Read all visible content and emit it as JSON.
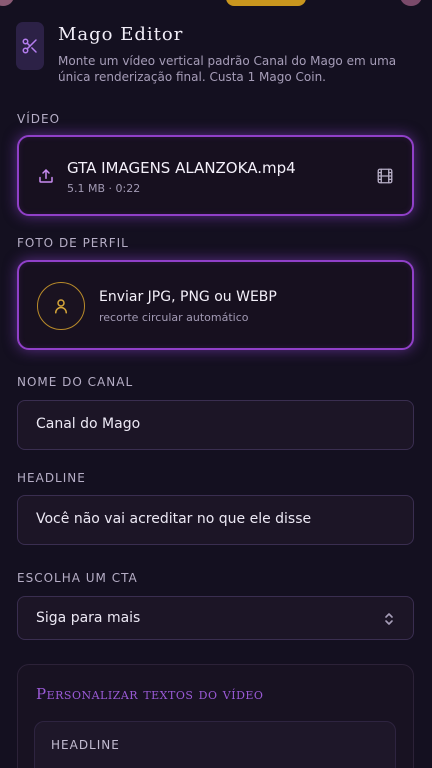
{
  "app": {
    "title": "Mago Editor",
    "description": "Monte um vídeo vertical padrão Canal do Mago em uma única renderização final. Custa 1 Mago Coin.",
    "logo_icon": "scissors-icon",
    "accent_color": "#9040c8"
  },
  "video": {
    "label": "VÍDEO",
    "file_name": "GTA IMAGENS ALANZOKA.mp4",
    "file_meta": "5.1 MB · 0:22"
  },
  "profile_photo": {
    "label": "FOTO DE PERFIL",
    "title": "Enviar JPG, PNG ou WEBP",
    "subtitle": "recorte circular automático"
  },
  "channel_name": {
    "label": "NOME DO CANAL",
    "value": "Canal do Mago"
  },
  "headline": {
    "label": "HEADLINE",
    "value": "Você não vai acreditar no que ele disse"
  },
  "cta": {
    "label": "ESCOLHA UM CTA",
    "selected": "Siga para mais"
  },
  "customize": {
    "title": "Personalizar textos do vídeo",
    "field_label": "HEADLINE"
  }
}
